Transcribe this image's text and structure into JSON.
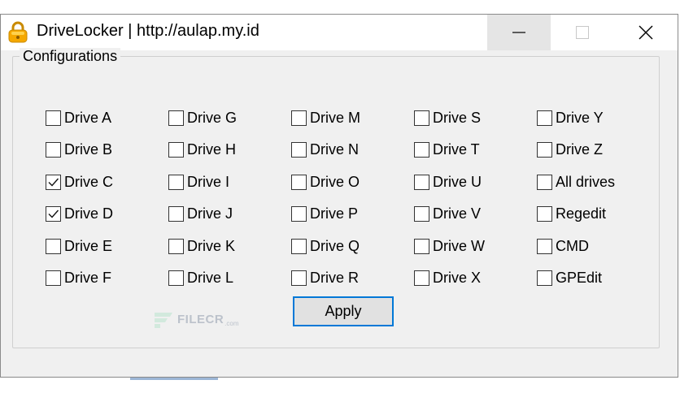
{
  "window": {
    "title": "DriveLocker | http://aulap.my.id",
    "icon": "padlock-icon",
    "accent_color": "#0078d7"
  },
  "group": {
    "label": "Configurations"
  },
  "checkboxes": [
    {
      "label": "Drive A",
      "checked": false
    },
    {
      "label": "Drive B",
      "checked": false
    },
    {
      "label": "Drive C",
      "checked": true
    },
    {
      "label": "Drive D",
      "checked": true
    },
    {
      "label": "Drive E",
      "checked": false
    },
    {
      "label": "Drive F",
      "checked": false
    },
    {
      "label": "Drive G",
      "checked": false
    },
    {
      "label": "Drive H",
      "checked": false
    },
    {
      "label": "Drive I",
      "checked": false
    },
    {
      "label": "Drive J",
      "checked": false
    },
    {
      "label": "Drive K",
      "checked": false
    },
    {
      "label": "Drive L",
      "checked": false
    },
    {
      "label": "Drive M",
      "checked": false
    },
    {
      "label": "Drive N",
      "checked": false
    },
    {
      "label": "Drive O",
      "checked": false
    },
    {
      "label": "Drive P",
      "checked": false
    },
    {
      "label": "Drive Q",
      "checked": false
    },
    {
      "label": "Drive R",
      "checked": false
    },
    {
      "label": "Drive S",
      "checked": false
    },
    {
      "label": "Drive T",
      "checked": false
    },
    {
      "label": "Drive U",
      "checked": false
    },
    {
      "label": "Drive V",
      "checked": false
    },
    {
      "label": "Drive W",
      "checked": false
    },
    {
      "label": "Drive X",
      "checked": false
    },
    {
      "label": "Drive Y",
      "checked": false
    },
    {
      "label": "Drive Z",
      "checked": false
    },
    {
      "label": "All drives",
      "checked": false
    },
    {
      "label": "Regedit",
      "checked": false
    },
    {
      "label": "CMD",
      "checked": false
    },
    {
      "label": "GPEdit",
      "checked": false
    }
  ],
  "apply_button": {
    "label": "Apply"
  },
  "watermark": {
    "text": "FILECR",
    "suffix": ".com"
  }
}
